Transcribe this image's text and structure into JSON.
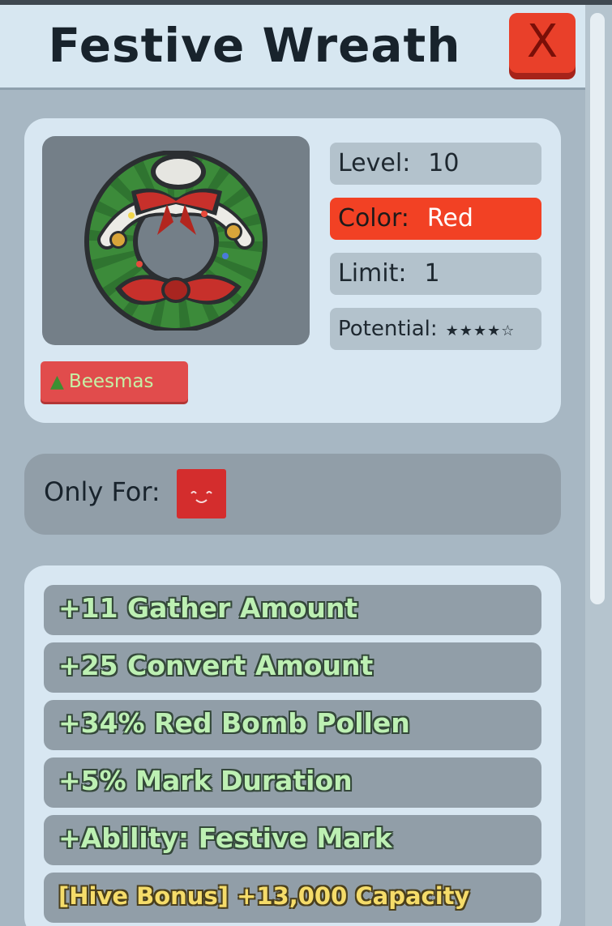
{
  "header": {
    "title": "Festive Wreath",
    "close_label": "X"
  },
  "item": {
    "icon": "festive-wreath-icon",
    "stats": {
      "level_label": "Level:",
      "level_value": "10",
      "color_label": "Color:",
      "color_value": "Red",
      "limit_label": "Limit:",
      "limit_value": "1",
      "potential_label": "Potential:",
      "potential_stars": "★★★★☆",
      "potential_value": 4,
      "potential_max": 5
    },
    "tag": {
      "icon": "christmas-tree-icon",
      "label": "Beesmas"
    }
  },
  "only_for": {
    "label": "Only For:",
    "icon": "red-bee-icon"
  },
  "bonuses": [
    "+11 Gather Amount",
    "+25 Convert Amount",
    "+34% Red Bomb Pollen",
    "+5% Mark Duration",
    "+Ability: Festive Mark",
    "[Hive Bonus] +13,000 Capacity"
  ],
  "colors": {
    "panel_bg": "#a7b7c3",
    "header_bg": "#d7e7f1",
    "card_bg": "#d8e7f2",
    "stat_bg": "#b3c2cc",
    "color_badge": "#f24124",
    "close_button": "#e9402a",
    "bonus_text": "#bdf0b3",
    "hive_bonus_text": "#f5dc6a",
    "tag_bg": "#e14c4c"
  }
}
